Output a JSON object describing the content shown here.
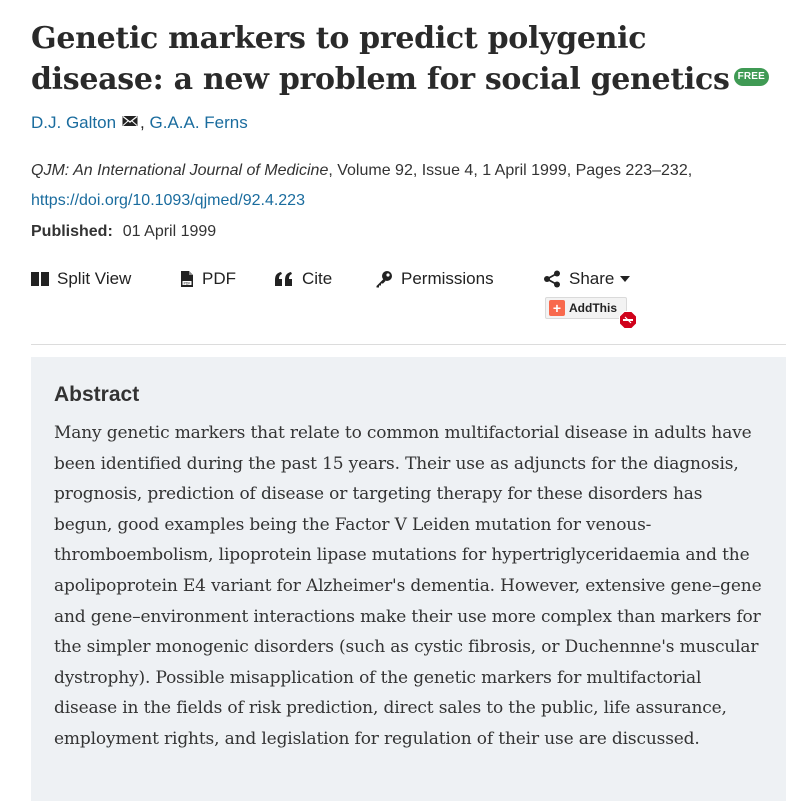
{
  "article": {
    "title": "Genetic markers to predict polygenic disease: a new problem for social genetics",
    "free_badge": "FREE",
    "authors": [
      {
        "name": "D.J. Galton",
        "has_mail": true
      },
      {
        "name": "G.A.A. Ferns",
        "has_mail": false
      }
    ],
    "author_separator": ", ",
    "citation": {
      "journal": "QJM: An International Journal of Medicine",
      "details": ", Volume 92, Issue 4, 1 April 1999, Pages 223–232,",
      "doi": "https://doi.org/10.1093/qjmed/92.4.223"
    },
    "published": {
      "label": "Published:",
      "date": "01 April 1999"
    }
  },
  "toolbar": {
    "split_view": "Split View",
    "pdf": "PDF",
    "cite": "Cite",
    "permissions": "Permissions",
    "share": "Share",
    "addthis": "AddThis"
  },
  "icons": {
    "split_view": "split-view-icon",
    "pdf": "pdf-icon",
    "cite": "quote-icon",
    "permissions": "key-icon",
    "share": "share-icon",
    "share_caret": "caret-down-icon",
    "mail": "envelope-icon",
    "addthis": "plus-icon",
    "adblock": "adblock-icon"
  },
  "abstract": {
    "heading": "Abstract",
    "text": "Many genetic markers that relate to common multifactorial disease in adults have been identified during the past 15 years. Their use as adjuncts for the diagnosis, prognosis, prediction of disease or targeting therapy for these disorders has begun, good examples being the Factor V Leiden mutation for venous-thromboembolism, lipoprotein lipase mutations for hypertriglyceridaemia and the apolipoprotein E4 variant for Alzheimer's dementia. However, extensive gene–gene and gene–environment interactions make their use more complex than markers for the simpler monogenic disorders (such as cystic fibrosis, or Duchennne's muscular dystrophy). Possible misapplication of the genetic markers for multifactorial disease in the fields of risk prediction, direct sales to the public, life assurance, employment rights, and legislation for regulation of their use are discussed."
  },
  "colors": {
    "link": "#1a6c9e",
    "free_badge": "#3f9a54",
    "abstract_bg": "#eef1f4",
    "addthis_orange": "#f8694d"
  }
}
